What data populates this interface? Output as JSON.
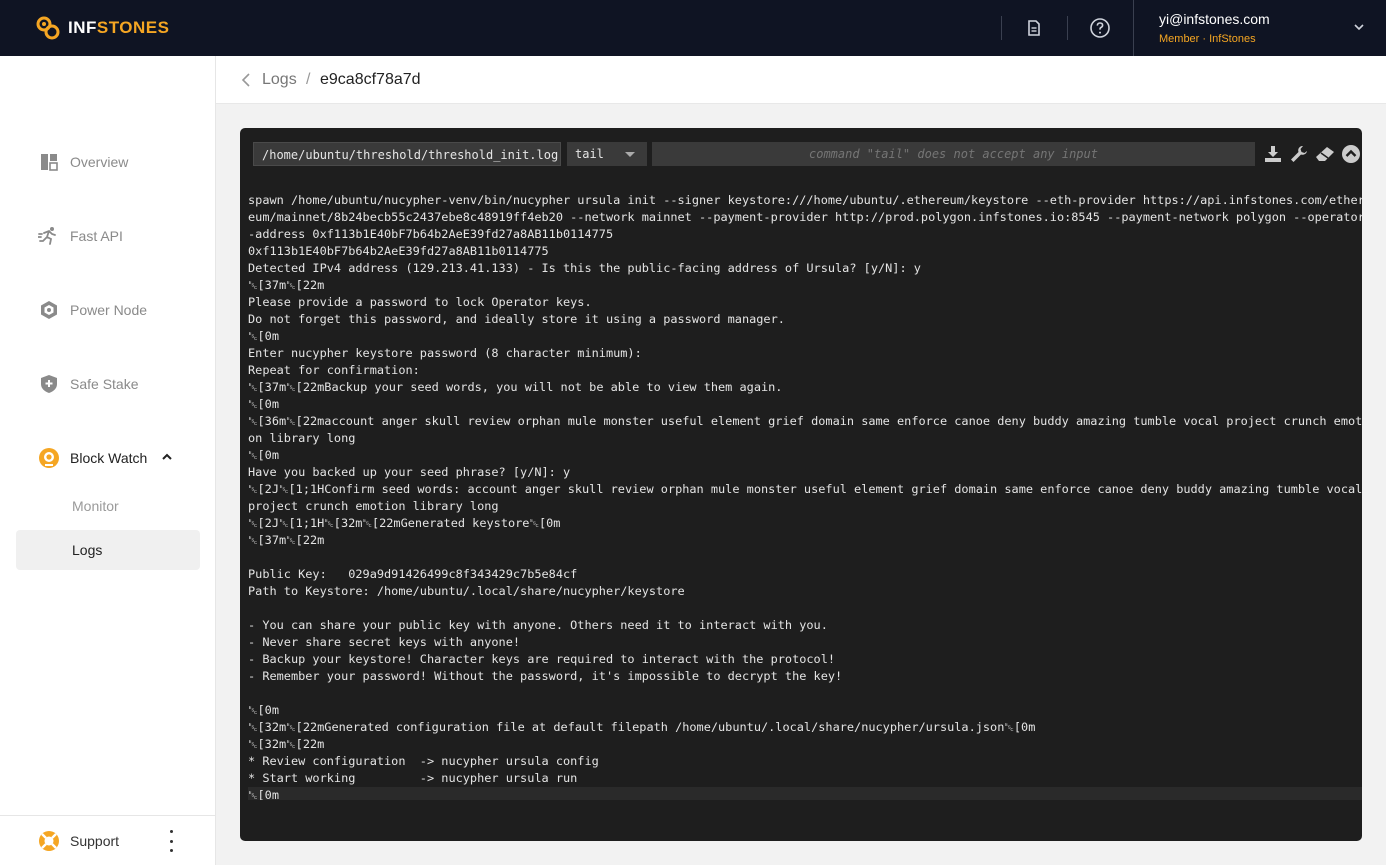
{
  "brand": {
    "prefix": "INF",
    "suffix": "STONES"
  },
  "user": {
    "email": "yi@infstones.com",
    "role": "Member · InfStones"
  },
  "sidebar": {
    "items": [
      {
        "label": "Overview",
        "icon": "dashboard-icon"
      },
      {
        "label": "Fast API",
        "icon": "running-icon"
      },
      {
        "label": "Power Node",
        "icon": "hexagon-node-icon"
      },
      {
        "label": "Safe Stake",
        "icon": "shield-icon"
      },
      {
        "label": "Block Watch",
        "icon": "eye-watch-icon"
      }
    ],
    "subitems": [
      {
        "label": "Monitor"
      },
      {
        "label": "Logs"
      }
    ],
    "support_label": "Support"
  },
  "breadcrumb": {
    "parent": "Logs",
    "separator": "/",
    "current": "e9ca8cf78a7d"
  },
  "terminal": {
    "path": "/home/ubuntu/threshold/threshold_init.log",
    "command": "tail",
    "arg_placeholder": "command \"tail\" does not accept any input",
    "tools": [
      "download-icon",
      "wrench-icon",
      "eraser-icon",
      "collapse-up-icon"
    ],
    "lines": [
      "spawn /home/ubuntu/nucypher-venv/bin/nucypher ursula init --signer keystore:///home/ubuntu/.ethereum/keystore --eth-provider https://api.infstones.com/ether",
      "eum/mainnet/8b24becb55c2437ebe8c48919ff4eb20 --network mainnet --payment-provider http://prod.polygon.infstones.io:8545 --payment-network polygon --operator",
      "-address 0xf113b1E40bF7b64b2AeE39fd27a8AB11b0114775",
      "0xf113b1E40bF7b64b2AeE39fd27a8AB11b0114775",
      "Detected IPv4 address (129.213.41.133) - Is this the public-facing address of Ursula? [y/N]: y",
      "␛[37m␛[22m",
      "Please provide a password to lock Operator keys.",
      "Do not forget this password, and ideally store it using a password manager.",
      "␛[0m",
      "Enter nucypher keystore password (8 character minimum):",
      "Repeat for confirmation:",
      "␛[37m␛[22mBackup your seed words, you will not be able to view them again.",
      "␛[0m",
      "␛[36m␛[22maccount anger skull review orphan mule monster useful element grief domain same enforce canoe deny buddy amazing tumble vocal project crunch emoti",
      "on library long",
      "␛[0m",
      "Have you backed up your seed phrase? [y/N]: y",
      "␛[2J␛[1;1HConfirm seed words: account anger skull review orphan mule monster useful element grief domain same enforce canoe deny buddy amazing tumble vocal",
      "project crunch emotion library long",
      "␛[2J␛[1;1H␛[32m␛[22mGenerated keystore␛[0m",
      "␛[37m␛[22m",
      "",
      "Public Key:   029a9d91426499c8f343429c7b5e84cf",
      "Path to Keystore: /home/ubuntu/.local/share/nucypher/keystore",
      "",
      "- You can share your public key with anyone. Others need it to interact with you.",
      "- Never share secret keys with anyone!",
      "- Backup your keystore! Character keys are required to interact with the protocol!",
      "- Remember your password! Without the password, it's impossible to decrypt the key!",
      "",
      "␛[0m",
      "␛[32m␛[22mGenerated configuration file at default filepath /home/ubuntu/.local/share/nucypher/ursula.json␛[0m",
      "␛[32m␛[22m",
      "* Review configuration  -> nucypher ursula config",
      "* Start working         -> nucypher ursula run",
      "␛[0m"
    ]
  },
  "colors": {
    "topbar": "#0f1423",
    "accent": "#f5a623",
    "terminal_bg": "#1e1e1e"
  }
}
